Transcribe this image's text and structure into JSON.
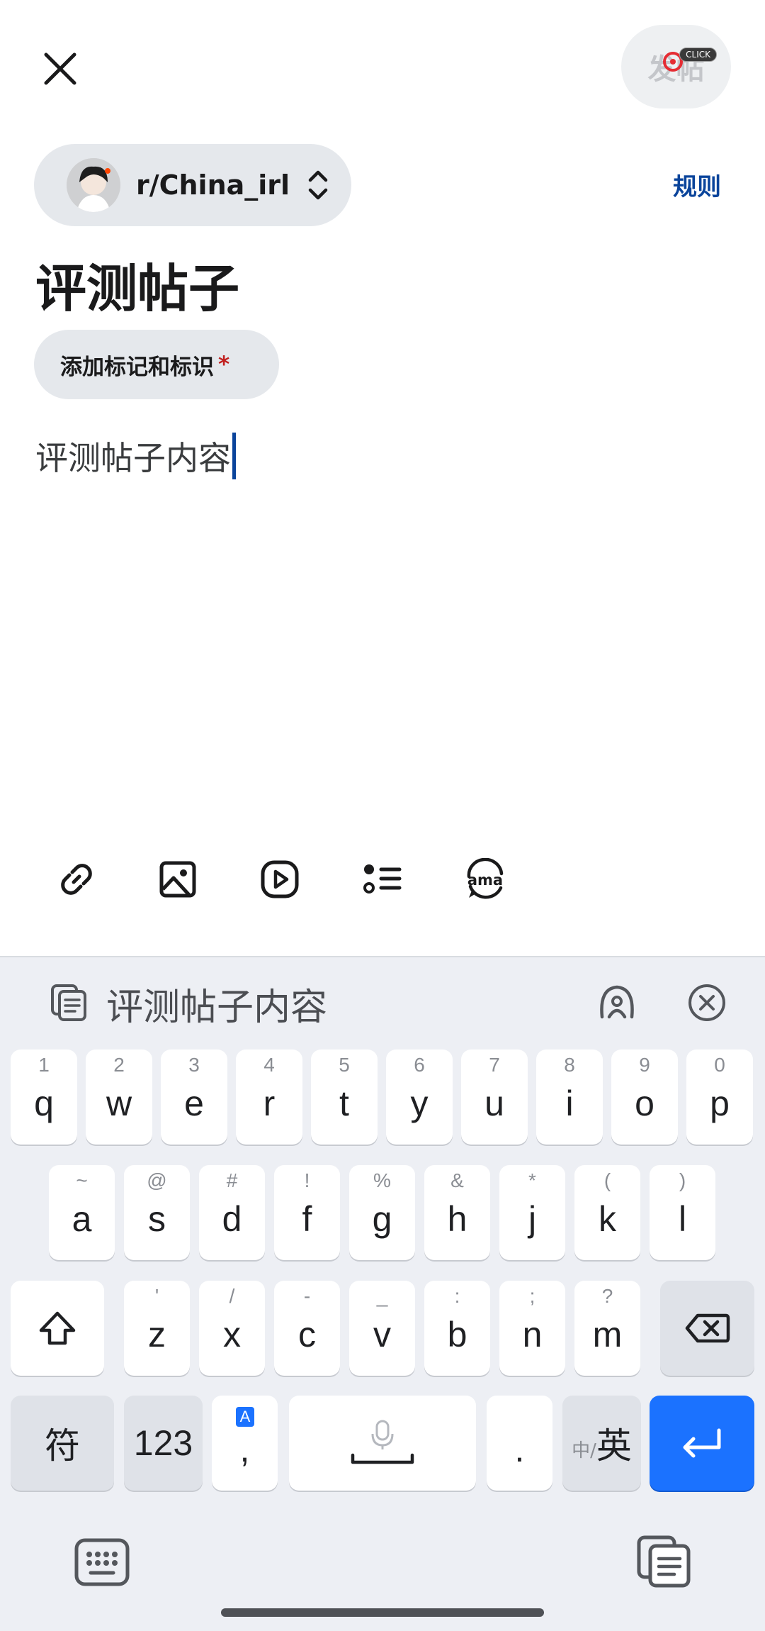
{
  "header": {
    "post_label": "发帖",
    "click_badge": "CLICK",
    "community": "r/China_irl",
    "rules_label": "规则"
  },
  "post": {
    "title": "评测帖子",
    "flair_label": "添加标记和标识",
    "required_mark": "*",
    "body": "评测帖子内容"
  },
  "toolbar": {
    "icons": [
      "link-icon",
      "image-icon",
      "video-icon",
      "list-icon",
      "ama-icon"
    ],
    "ama_text": "ama"
  },
  "keyboard": {
    "clipboard_text": "评测帖子内容",
    "row1": [
      {
        "k": "q",
        "h": "1"
      },
      {
        "k": "w",
        "h": "2"
      },
      {
        "k": "e",
        "h": "3"
      },
      {
        "k": "r",
        "h": "4"
      },
      {
        "k": "t",
        "h": "5"
      },
      {
        "k": "y",
        "h": "6"
      },
      {
        "k": "u",
        "h": "7"
      },
      {
        "k": "i",
        "h": "8"
      },
      {
        "k": "o",
        "h": "9"
      },
      {
        "k": "p",
        "h": "0"
      }
    ],
    "row2": [
      {
        "k": "a",
        "h": "~"
      },
      {
        "k": "s",
        "h": "@"
      },
      {
        "k": "d",
        "h": "#"
      },
      {
        "k": "f",
        "h": "!"
      },
      {
        "k": "g",
        "h": "%"
      },
      {
        "k": "h",
        "h": "&"
      },
      {
        "k": "j",
        "h": "*"
      },
      {
        "k": "k",
        "h": "("
      },
      {
        "k": "l",
        "h": ")"
      }
    ],
    "row3": [
      {
        "k": "z",
        "h": "'"
      },
      {
        "k": "x",
        "h": "/"
      },
      {
        "k": "c",
        "h": "-"
      },
      {
        "k": "v",
        "h": "_"
      },
      {
        "k": "b",
        "h": ":"
      },
      {
        "k": "n",
        "h": ";"
      },
      {
        "k": "m",
        "h": "?"
      }
    ],
    "symbols_label": "符",
    "numbers_label": "123",
    "comma_label": ",",
    "comma_badge": "A",
    "period_label": ".",
    "lang_small": "中/",
    "lang_label": "英"
  },
  "colors": {
    "accent": "#0a449b",
    "enter_key": "#1b72ff",
    "required": "#c1201f"
  }
}
